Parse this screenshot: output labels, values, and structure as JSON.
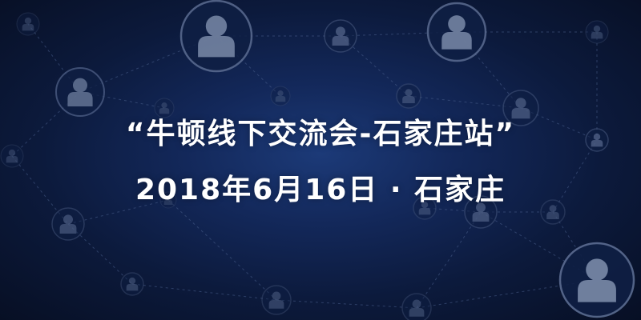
{
  "event": {
    "title": "“牛顿线下交流会-石家庄站”",
    "date_location": "2018年6月16日 · 石家庄"
  },
  "colors": {
    "background_center": "#1c3a78",
    "background_edge": "#070f24",
    "avatar": "#7a8aa8",
    "text": "#ffffff"
  },
  "background_icons": [
    "user-avatar-icon",
    "network-line"
  ]
}
